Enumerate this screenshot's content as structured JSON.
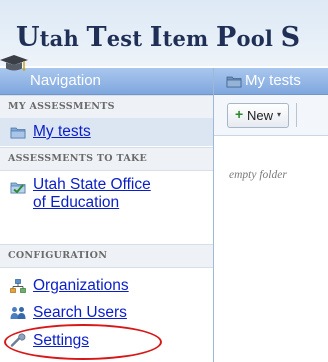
{
  "app": {
    "title_parts": [
      "U",
      "tah ",
      "T",
      "est ",
      "I",
      "tem ",
      "P",
      "ool ",
      "S"
    ]
  },
  "icons": {
    "cap": "graduation-cap-icon",
    "folder": "folder-icon",
    "state": "state-folder-icon",
    "organizations": "organization-tree-icon",
    "users": "users-icon",
    "settings": "wrench-icon"
  },
  "navigation": {
    "header": "Navigation",
    "sections": [
      {
        "label": "MY ASSESSMENTS"
      },
      {
        "label": "ASSESSMENTS TO TAKE"
      },
      {
        "label": "CONFIGURATION"
      }
    ],
    "items": {
      "my_tests": "My tests",
      "utah_line1": "Utah State Office",
      "utah_line2": "of Education",
      "organizations": "Organizations",
      "search_users": "Search Users",
      "settings": "Settings"
    }
  },
  "main": {
    "tab_title": "My tests",
    "toolbar": {
      "new_plus": "+",
      "new_label": "New",
      "new_caret": "▾"
    },
    "empty_message": "empty folder"
  },
  "colors": {
    "link": "#0a1ec8",
    "header_gradient_top": "#a9c7ee",
    "header_gradient_bottom": "#7fa7de",
    "highlight": "#d81818"
  }
}
